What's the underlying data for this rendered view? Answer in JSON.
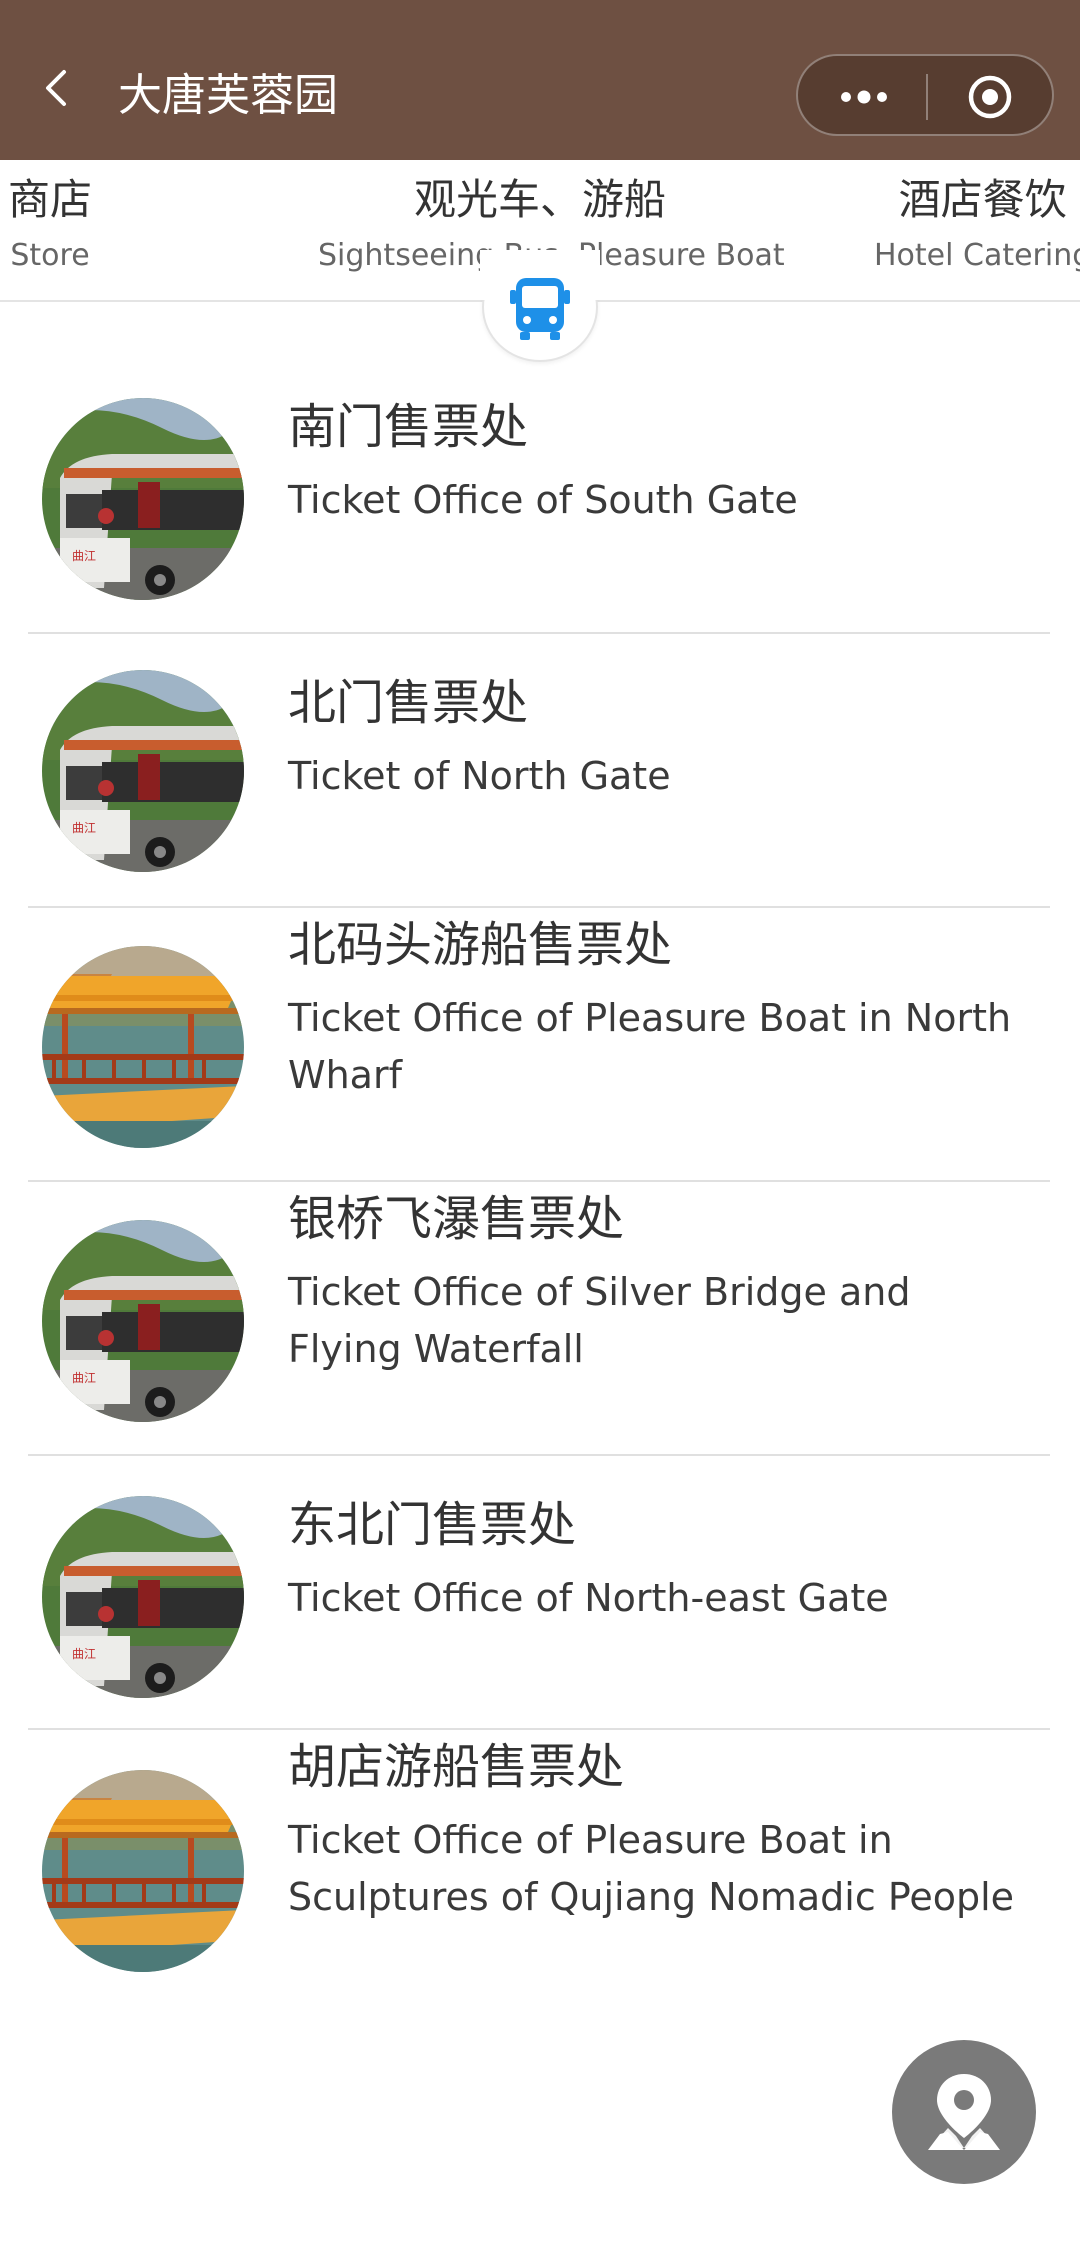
{
  "header": {
    "title": "大唐芙蓉园"
  },
  "tabs": [
    {
      "cn": "商店",
      "en": "Store"
    },
    {
      "cn": "观光车、游船",
      "en": "Sightseeing Bus, Pleasure Boat"
    },
    {
      "cn": "酒店餐饮",
      "en": "Hotel Catering"
    }
  ],
  "active_tab_icon": "bus-icon",
  "items": [
    {
      "cn": "南门售票处",
      "en": "Ticket Office of South Gate",
      "image": "sightseeing-bus"
    },
    {
      "cn": "北门售票处",
      "en": "Ticket of North Gate",
      "image": "sightseeing-bus"
    },
    {
      "cn": "北码头游船售票处",
      "en": "Ticket Office of Pleasure Boat in North Wharf",
      "image": "pleasure-boat"
    },
    {
      "cn": "银桥飞瀑售票处",
      "en": "Ticket Office of Silver Bridge and Flying Waterfall",
      "image": "sightseeing-bus"
    },
    {
      "cn": "东北门售票处",
      "en": "Ticket Office of North-east Gate",
      "image": "sightseeing-bus"
    },
    {
      "cn": "胡店游船售票处",
      "en": "Ticket Office of Pleasure Boat in Sculptures of Qujiang Nomadic People",
      "image": "pleasure-boat"
    }
  ],
  "colors": {
    "header_bg": "#6e5042",
    "accent_blue": "#1e90e8",
    "fab_bg": "#7a7a7a"
  }
}
